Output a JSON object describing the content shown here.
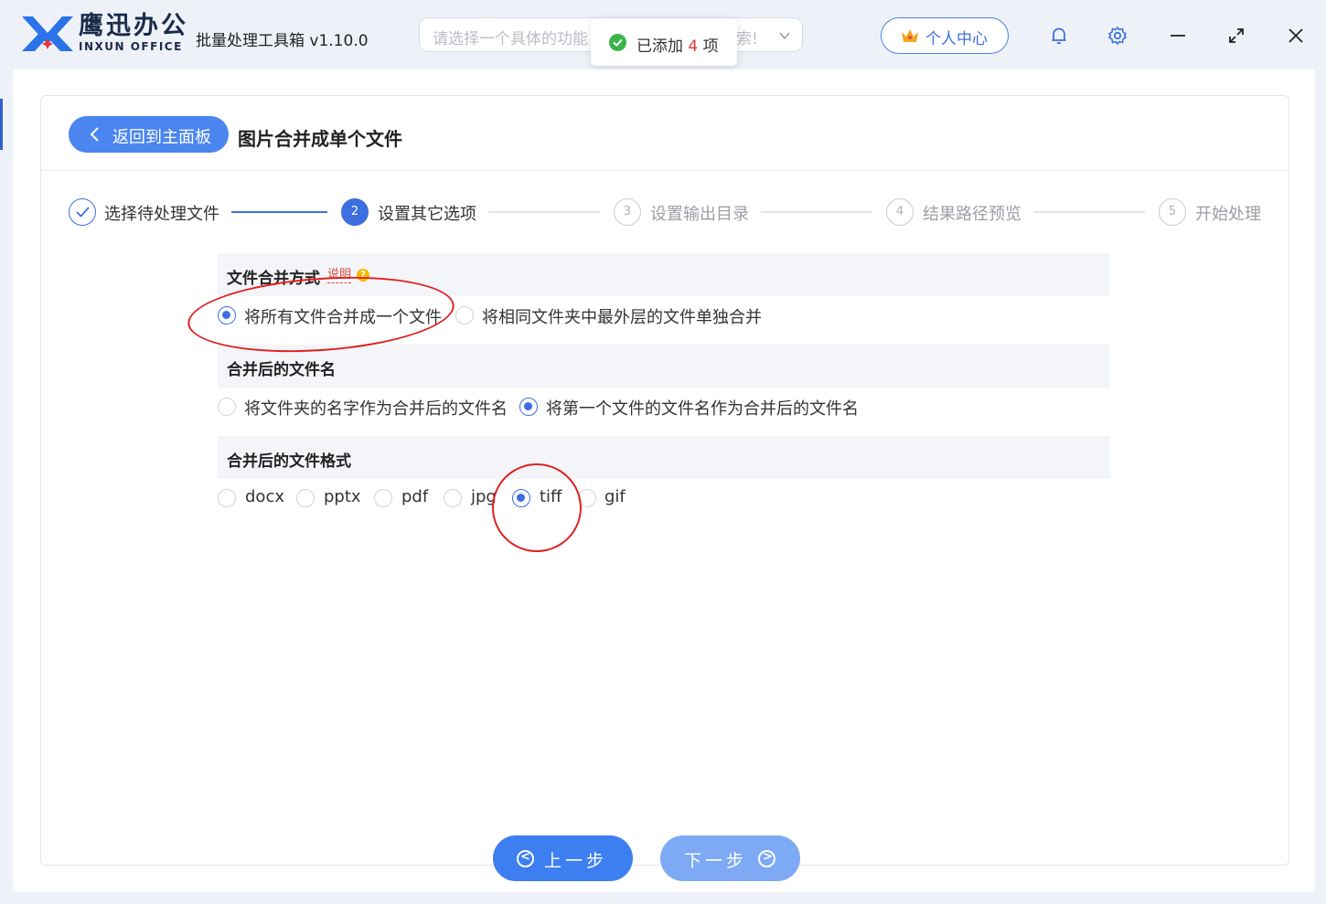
{
  "app": {
    "brand_cn": "鹰迅办公",
    "brand_en": "INXUN OFFICE",
    "title": "批量处理工具箱 v1.10.0"
  },
  "search": {
    "placeholder": "请选择一个具体的功能",
    "suffix": "索!"
  },
  "toast": {
    "prefix": "已添加",
    "count": "4",
    "suffix": "项"
  },
  "header": {
    "profile_label": "个人中心"
  },
  "page": {
    "back_label": "返回到主面板",
    "title": "图片合并成单个文件"
  },
  "steps": [
    {
      "num": "✓",
      "label": "选择待处理文件",
      "state": "done"
    },
    {
      "num": "2",
      "label": "设置其它选项",
      "state": "active"
    },
    {
      "num": "3",
      "label": "设置输出目录",
      "state": "todo"
    },
    {
      "num": "4",
      "label": "结果路径预览",
      "state": "todo"
    },
    {
      "num": "5",
      "label": "开始处理",
      "state": "todo"
    }
  ],
  "sections": {
    "merge_mode": {
      "title": "文件合并方式",
      "explain": "说明",
      "help": "?",
      "options": [
        "将所有文件合并成一个文件",
        "将相同文件夹中最外层的文件单独合并"
      ],
      "selected": 0
    },
    "file_name": {
      "title": "合并后的文件名",
      "options": [
        "将文件夹的名字作为合并后的文件名",
        "将第一个文件的文件名作为合并后的文件名"
      ],
      "selected": 1
    },
    "file_format": {
      "title": "合并后的文件格式",
      "options": [
        "docx",
        "pptx",
        "pdf",
        "jpg",
        "tiff",
        "gif"
      ],
      "selected": 4
    }
  },
  "footer": {
    "prev_label": "上一步",
    "next_label": "下一步"
  },
  "colors": {
    "accent": "#3d6fe0",
    "button": "#4a85f0",
    "annotation": "#e02020",
    "success": "#3bb54a"
  }
}
